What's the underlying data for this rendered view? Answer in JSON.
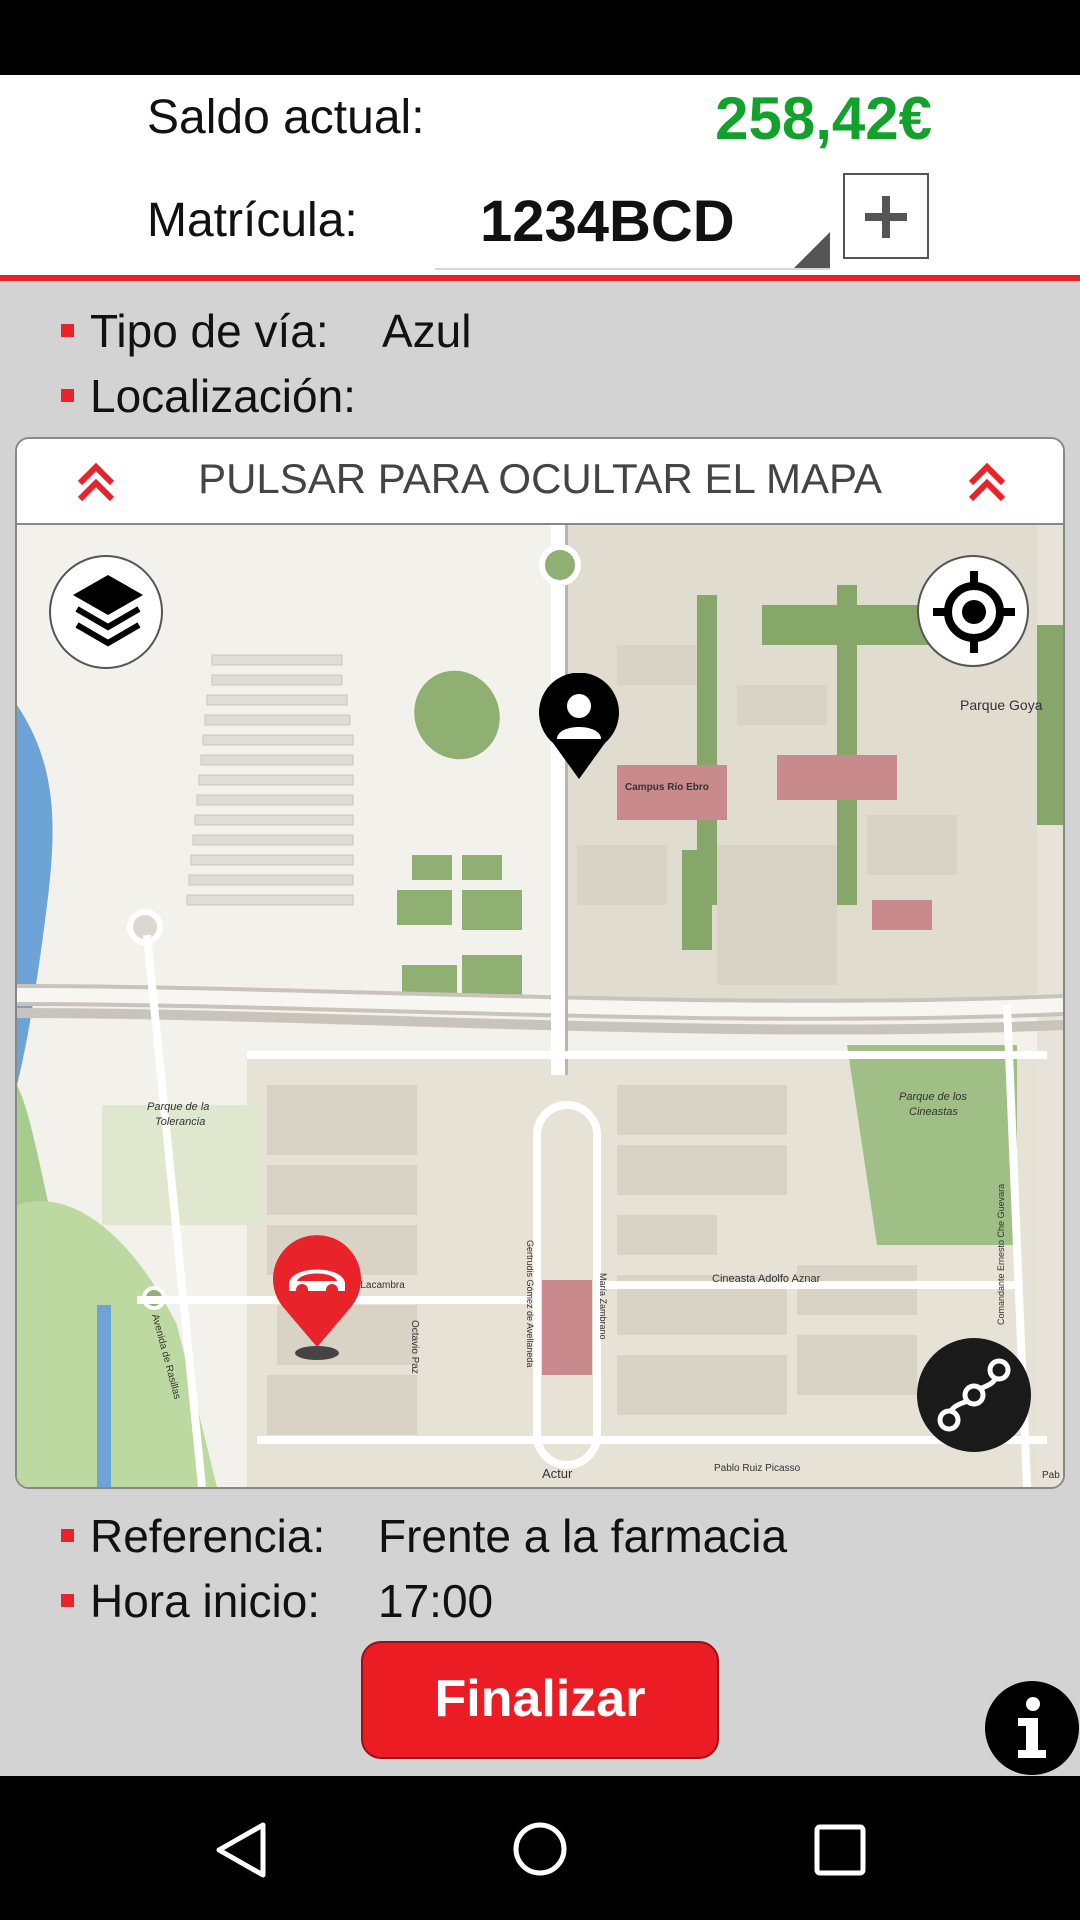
{
  "header": {
    "balance_label": "Saldo actual:",
    "balance_value": "258,42€",
    "plate_label": "Matrícula:",
    "plate_value": "1234BCD"
  },
  "info": {
    "road_type_label": "Tipo de vía:",
    "road_type_value": "Azul",
    "location_label": "Localización:",
    "reference_label": "Referencia:",
    "reference_value": "Frente a la farmacia",
    "start_label": "Hora inicio:",
    "start_value": "17:00"
  },
  "map": {
    "toggle_label": "PULSAR PARA OCULTAR EL MAPA",
    "labels": {
      "parque_goya": "Parque Goya",
      "campus": "Campus Río Ebro",
      "parque_tolerancia_1": "Parque de la",
      "parque_tolerancia_2": "Tolerancia",
      "parque_cineastas_1": "Parque de los",
      "parque_cineastas_2": "Cineastas",
      "cineasta": "Cineasta Adolfo Aznar",
      "actur": "Actur",
      "pablo": "Pablo Ruiz Picasso",
      "lacambra": "az Lacambra",
      "rasillas": "Avenida de Rasillas",
      "octavio": "Octavio Paz",
      "gertrudis": "Gertrudis Gómez de Avellaneda",
      "maria": "María Zambrano",
      "ernesto": "Comandante Ernesto Che Guevara",
      "pab": "Pab"
    }
  },
  "actions": {
    "finalize_label": "Finalizar"
  },
  "colors": {
    "accent_red": "#e8232a",
    "balance_green": "#12a12a"
  }
}
